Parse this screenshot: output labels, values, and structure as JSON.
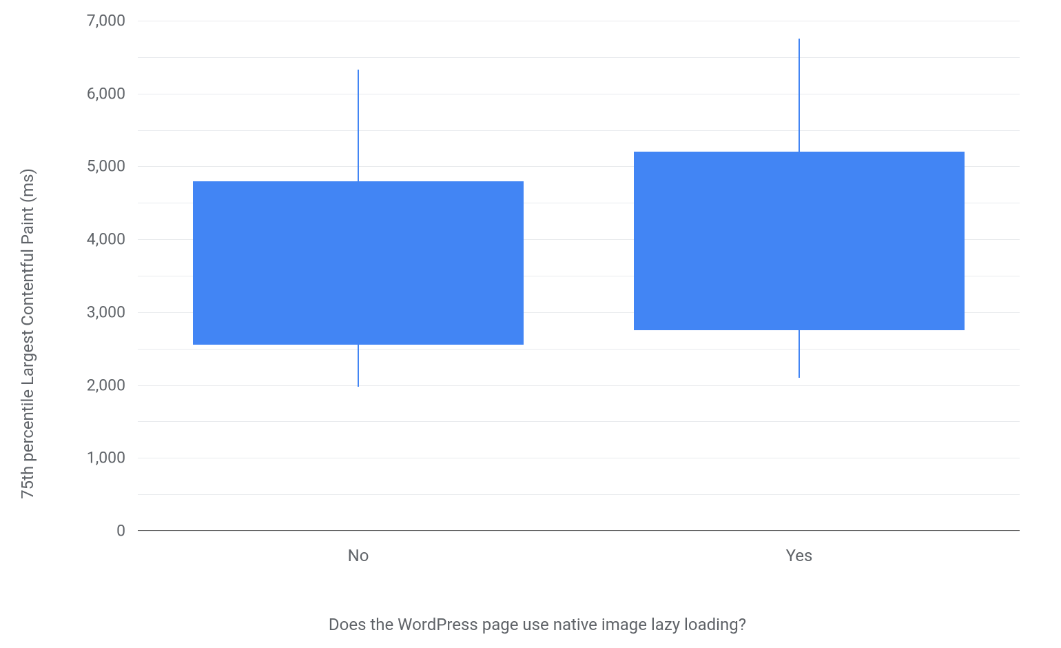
{
  "chart_data": {
    "type": "boxplot",
    "ylabel": "75th percentile Largest Contentful Paint (ms)",
    "xlabel": "Does the WordPress page use native image lazy loading?",
    "categories": [
      "No",
      "Yes"
    ],
    "ylim": [
      0,
      7000
    ],
    "y_ticks": [
      0,
      1000,
      2000,
      3000,
      4000,
      5000,
      6000,
      7000
    ],
    "y_tick_labels": [
      "0",
      "1,000",
      "2,000",
      "3,000",
      "4,000",
      "5,000",
      "6,000",
      "7,000"
    ],
    "series": [
      {
        "name": "No",
        "whisker_low": 1980,
        "q1": 2550,
        "q3": 4800,
        "whisker_high": 6330
      },
      {
        "name": "Yes",
        "whisker_low": 2100,
        "q1": 2750,
        "q3": 5200,
        "whisker_high": 6750
      }
    ],
    "box_color": "#4285f4",
    "grid": true
  }
}
